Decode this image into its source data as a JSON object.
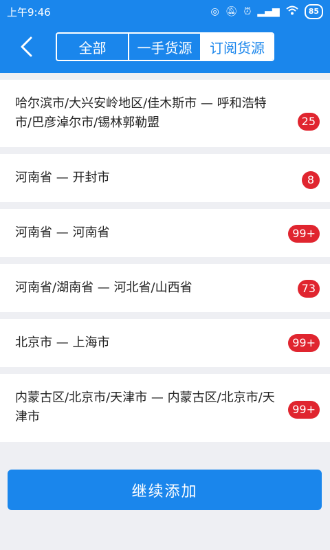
{
  "status": {
    "time": "上午9:46",
    "battery": "85",
    "icons": [
      "hd-signal-icon",
      "mute-icon",
      "alarm-icon",
      "signal-icon",
      "wifi-icon",
      "battery-icon"
    ]
  },
  "nav": {
    "back_icon": "chevron-left-icon",
    "tabs": [
      {
        "label": "全部",
        "selected": false
      },
      {
        "label": "一手货源",
        "selected": false
      },
      {
        "label": "订阅货源",
        "selected": true
      }
    ]
  },
  "subscriptions": [
    {
      "route": "哈尔滨市/大兴安岭地区/佳木斯市 — 呼和浩特市/巴彦淖尔市/锡林郭勒盟",
      "count": "25"
    },
    {
      "route": "河南省 — 开封市",
      "count": "8"
    },
    {
      "route": "河南省 — 河南省",
      "count": "99+"
    },
    {
      "route": "河南省/湖南省 — 河北省/山西省",
      "count": "73"
    },
    {
      "route": "北京市 — 上海市",
      "count": "99+"
    },
    {
      "route": "内蒙古区/北京市/天津市 — 内蒙古区/北京市/天津市",
      "count": "99+"
    }
  ],
  "actions": {
    "add_more": "继续添加"
  },
  "colors": {
    "primary": "#1a86ec",
    "badge": "#e0252f",
    "background": "#eeeff3"
  }
}
